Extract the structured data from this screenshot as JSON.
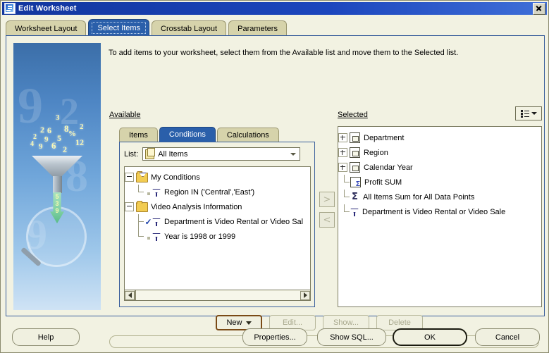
{
  "window": {
    "title": "Edit Worksheet",
    "icon": "app-icon",
    "close_label": "Close"
  },
  "tabs": [
    {
      "label": "Worksheet Layout",
      "active": false
    },
    {
      "label": "Select Items",
      "active": true
    },
    {
      "label": "Crosstab Layout",
      "active": false
    },
    {
      "label": "Parameters",
      "active": false
    }
  ],
  "instruction": "To add items to your worksheet, select them from the Available list and move them to the Selected list.",
  "available": {
    "label": "Available",
    "label_accel": "A",
    "inner_tabs": [
      {
        "label": "Items",
        "active": false
      },
      {
        "label": "Conditions",
        "active": true
      },
      {
        "label": "Calculations",
        "active": false
      }
    ],
    "list_label": "List:",
    "list_value": "All Items",
    "list_icon": "document-stack-icon",
    "tree": [
      {
        "level": 0,
        "label": "My Conditions",
        "icon": "folder-filter-icon",
        "expander": "minus",
        "checked": null
      },
      {
        "level": 1,
        "label": "Region IN ('Central','East')",
        "icon": "filter-icon",
        "expander": null,
        "checked": false
      },
      {
        "level": 0,
        "label": "Video Analysis Information",
        "icon": "folder-icon",
        "expander": "minus",
        "checked": null
      },
      {
        "level": 1,
        "label": "Department is Video Rental or Video Sal",
        "icon": "filter-icon",
        "expander": null,
        "checked": true
      },
      {
        "level": 1,
        "label": "Year is 1998 or 1999",
        "icon": "filter-icon",
        "expander": null,
        "checked": false
      }
    ],
    "scrollbar": {
      "left_arrow": "scroll-left-icon",
      "right_arrow": "scroll-right-icon"
    }
  },
  "transfer": {
    "add_label": ">",
    "remove_label": "<"
  },
  "selected": {
    "label": "Selected",
    "label_accel": "S",
    "view_options_icon": "list-view-icon",
    "items": [
      {
        "label": "Department",
        "icon": "item-icon",
        "expander": "plus"
      },
      {
        "label": "Region",
        "icon": "item-icon",
        "expander": "plus"
      },
      {
        "label": "Calendar Year",
        "icon": "item-icon",
        "expander": "plus"
      },
      {
        "label": "Profit SUM",
        "icon": "item-sum-icon",
        "expander": null
      },
      {
        "label": "All Items Sum for All Data Points",
        "icon": "sigma-icon",
        "expander": null
      },
      {
        "label": "Department is Video Rental or Video Sale",
        "icon": "filter-icon",
        "expander": null
      }
    ]
  },
  "condition_buttons": [
    {
      "label": "New",
      "state": "focus",
      "has_caret": true
    },
    {
      "label": "Edit...",
      "state": "disabled",
      "has_caret": false
    },
    {
      "label": "Show...",
      "state": "disabled",
      "has_caret": false
    },
    {
      "label": "Delete",
      "state": "disabled",
      "has_caret": false
    }
  ],
  "description_box": "",
  "bottom_buttons": [
    {
      "label": "Help",
      "state": "normal"
    },
    {
      "label": "Properties...",
      "state": "normal"
    },
    {
      "label": "Show SQL...",
      "state": "normal"
    },
    {
      "label": "OK",
      "state": "default"
    },
    {
      "label": "Cancel",
      "state": "normal"
    }
  ],
  "illustration": {
    "name": "funnel-magnifier-illustration",
    "floating_numbers": [
      "3",
      "8",
      "2",
      "2",
      "6",
      "%",
      "2",
      "9",
      "5",
      "12",
      "4",
      "9",
      "6",
      "2"
    ],
    "arrow_numbers": [
      "5",
      "3",
      "9"
    ],
    "ghost_numbers": [
      "9",
      "2",
      "8",
      "9"
    ]
  }
}
